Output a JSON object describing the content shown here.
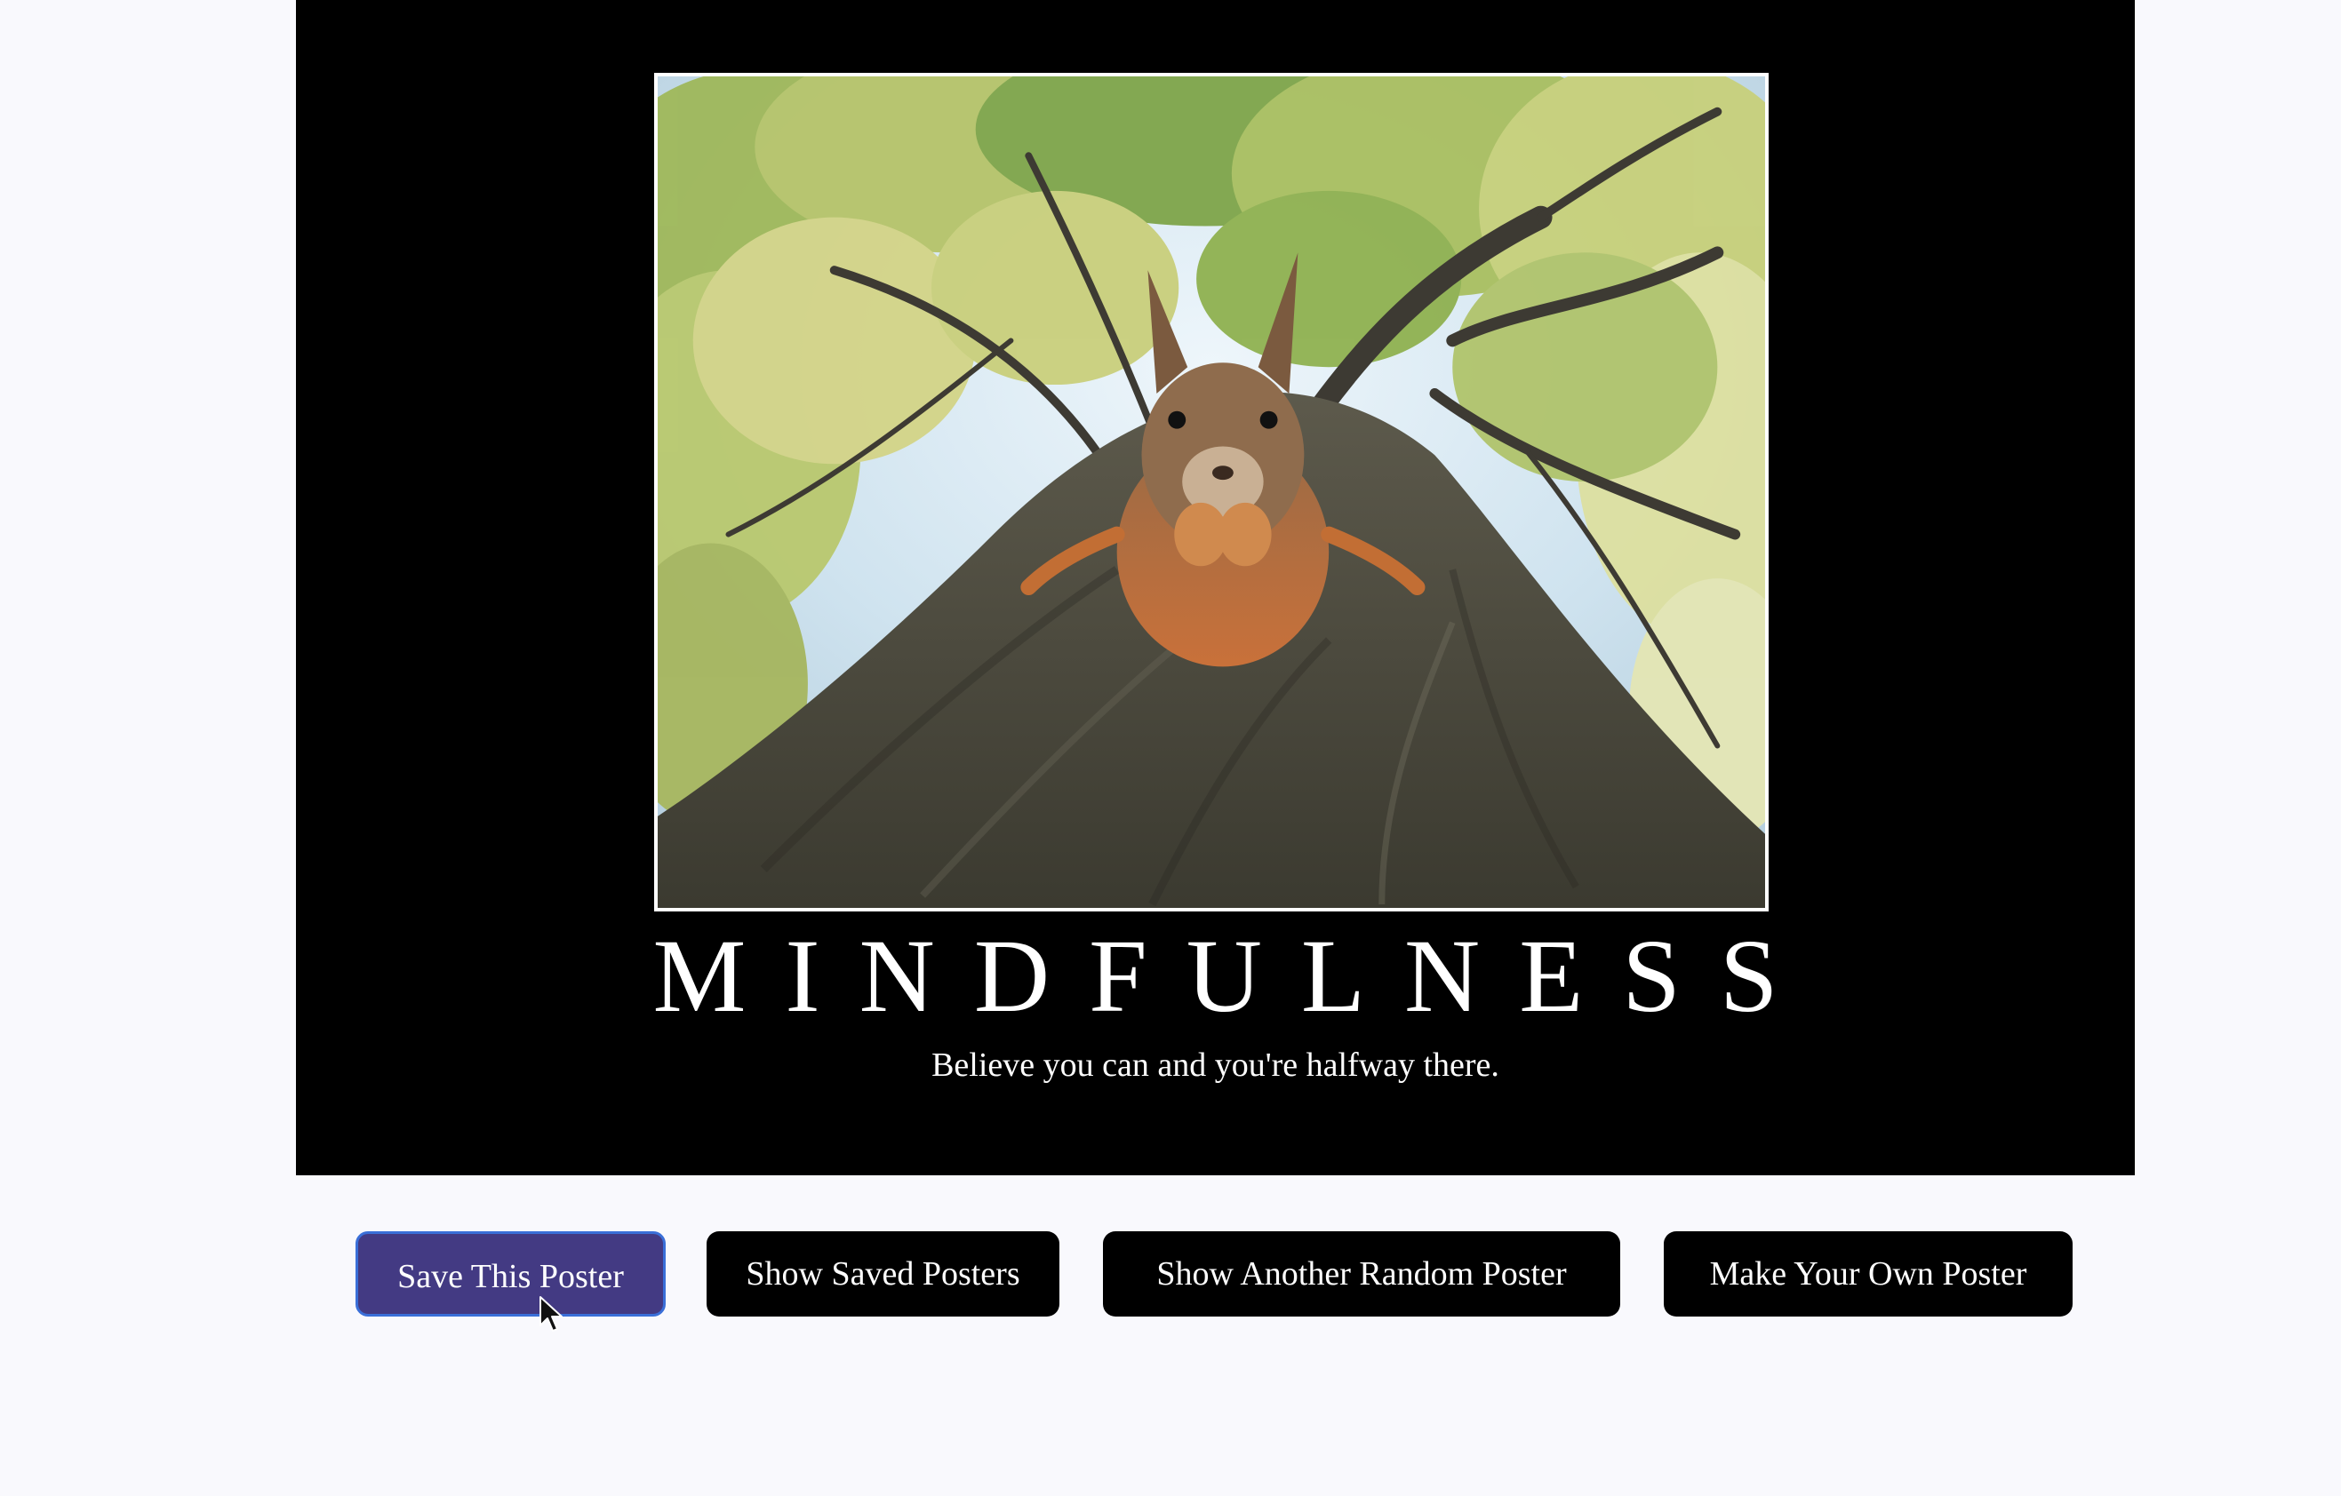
{
  "poster": {
    "title": "MINDFULNESS",
    "quote": "Believe you can and you're halfway there.",
    "image_subject": "squirrel-on-tree-trunk"
  },
  "buttons": {
    "save": "Save This Poster",
    "show_saved": "Show Saved Posters",
    "random": "Show Another Random Poster",
    "make_own": "Make Your Own Poster"
  },
  "colors": {
    "page_background": "#f9f9fd",
    "poster_background": "#000000",
    "button_background": "#000000",
    "save_button_active": "#433a83",
    "save_button_focus_border": "#3a6fd8"
  }
}
